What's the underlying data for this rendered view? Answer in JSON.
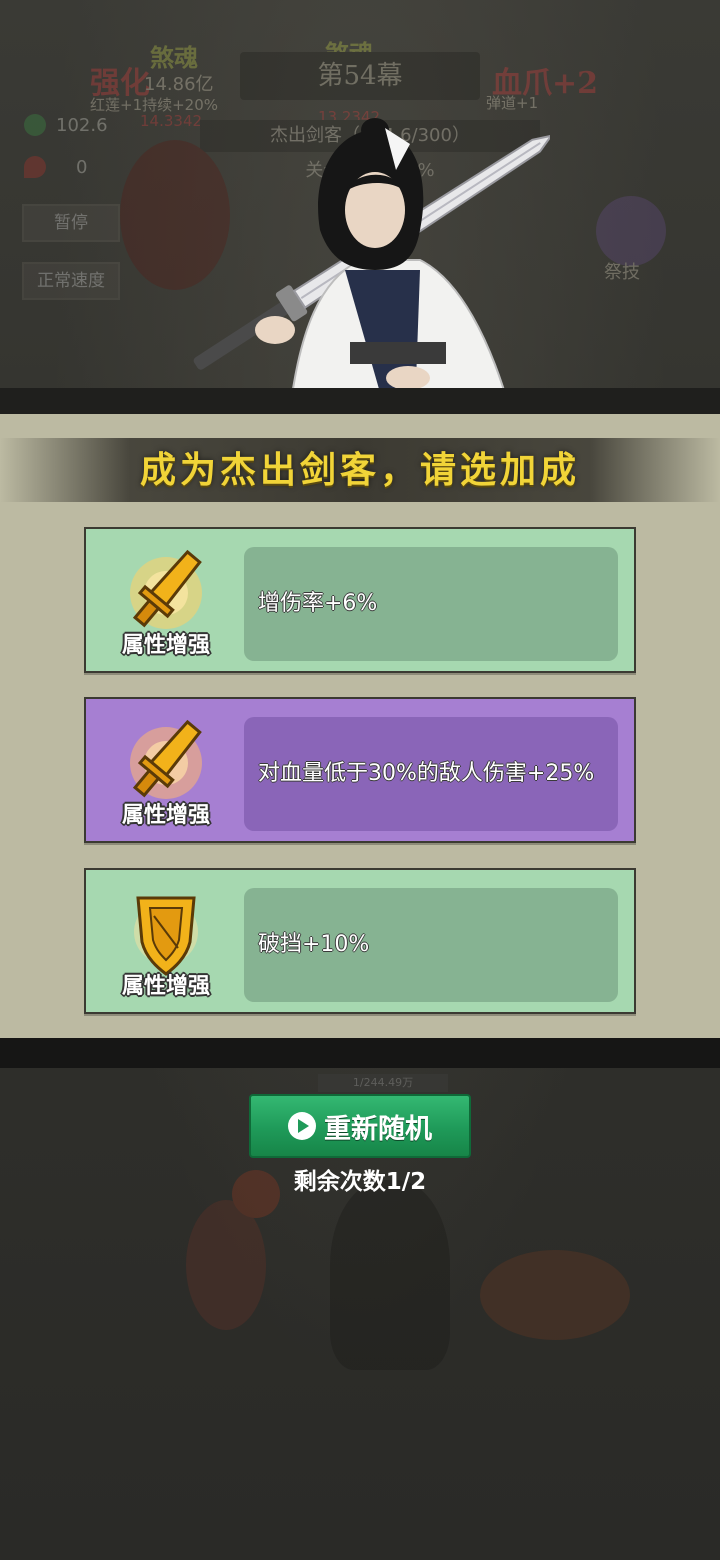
{
  "background": {
    "soul_left_title": "煞魂",
    "soul_left_value": "14.86亿",
    "soul_left_sub": "14.3342",
    "soul_right_title": "煞魂",
    "soul_right_value": "13.2342",
    "strengthen_text": "强化",
    "blood_claw_text": "血爪+2",
    "pierce_text": "弹道+1",
    "red_lotus_text": "红莲+1持续+20%",
    "stat_green_value": "102.6",
    "stat_red_value": "0",
    "pause_button": "暂停",
    "speed_button": "正常速度",
    "stage_title": "第54幕",
    "rank_text": "杰出剑客（284.6/300）",
    "progress_text": "关卡进度82.5%",
    "skill_label": "祭技",
    "enemy_hp": "1/244.49万"
  },
  "modal": {
    "title": "成为杰出剑客，请选加成",
    "cards": [
      {
        "icon": "golden-sword-icon",
        "label": "属性增强",
        "description": "增伤率+6%",
        "rarity": "green"
      },
      {
        "icon": "golden-sword-icon",
        "label": "属性增强",
        "description": "对血量低于30%的敌人伤害+25%",
        "rarity": "purple"
      },
      {
        "icon": "golden-shield-icon",
        "label": "属性增强",
        "description": "破挡+10%",
        "rarity": "green"
      }
    ]
  },
  "reroll": {
    "button_label": "重新随机",
    "remaining_text": "剩余次数1/2",
    "icon": "play-icon"
  },
  "colors": {
    "green_card": "#a6d8b0",
    "purple_card": "#a67fd2",
    "title_gold": "#f1d438",
    "reroll_green": "#1f9a59"
  }
}
